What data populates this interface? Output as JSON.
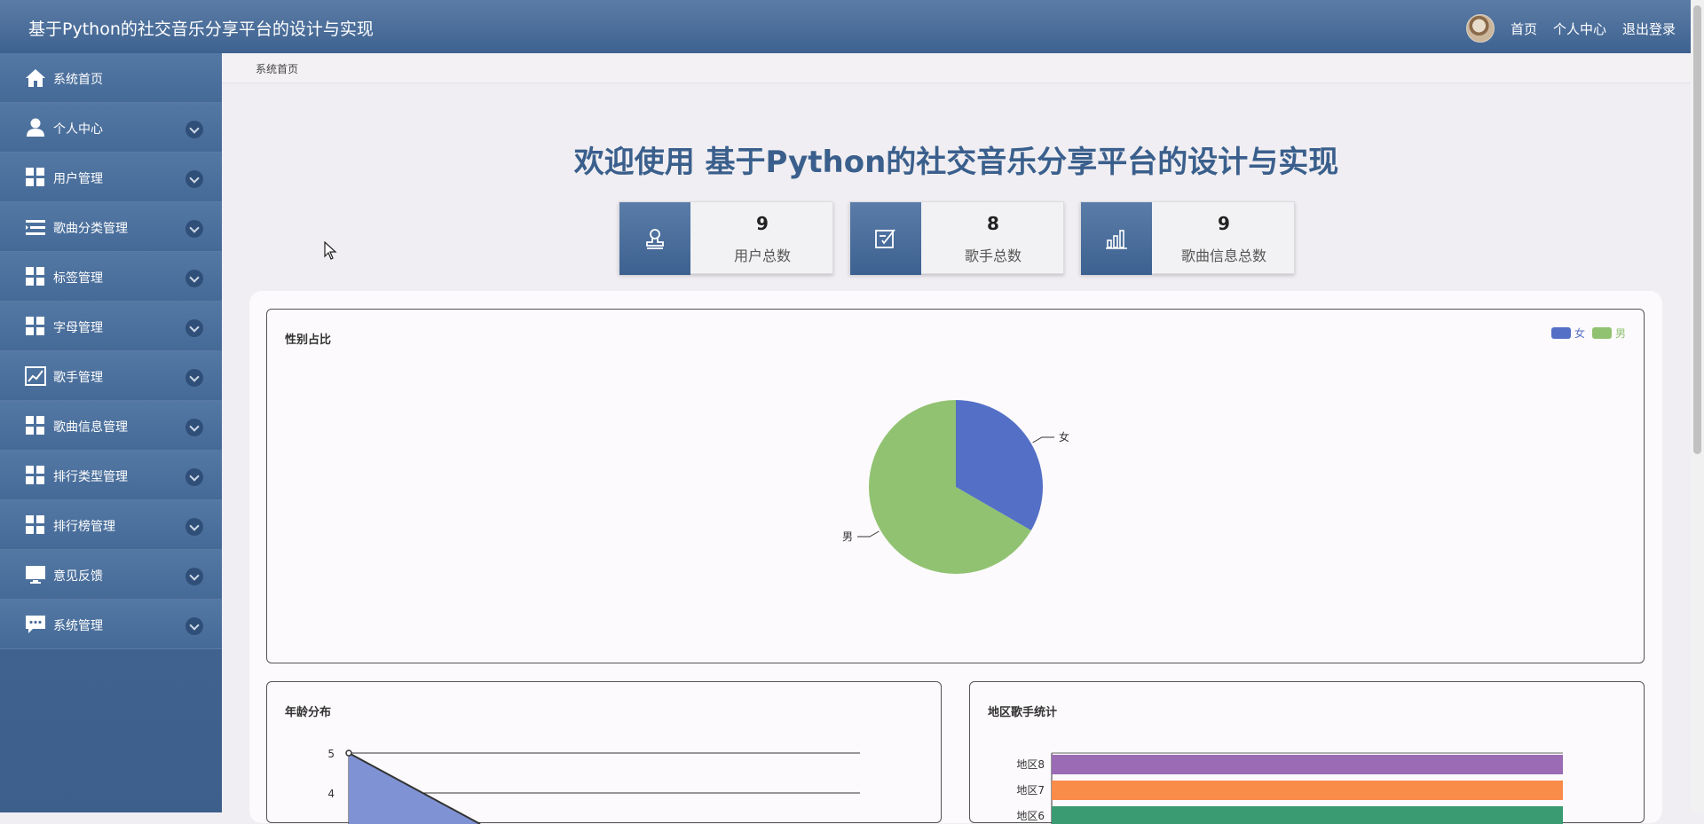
{
  "header": {
    "app_title": "基于Python的社交音乐分享平台的设计与实现",
    "links": [
      "首页",
      "个人中心",
      "退出登录"
    ]
  },
  "sidebar": {
    "items": [
      {
        "label": "系统首页",
        "icon": "home-icon",
        "has_chevron": false
      },
      {
        "label": "个人中心",
        "icon": "person-icon",
        "has_chevron": true
      },
      {
        "label": "用户管理",
        "icon": "grid-icon",
        "has_chevron": true
      },
      {
        "label": "歌曲分类管理",
        "icon": "list-icon",
        "has_chevron": true
      },
      {
        "label": "标签管理",
        "icon": "grid-icon",
        "has_chevron": true
      },
      {
        "label": "字母管理",
        "icon": "grid-icon",
        "has_chevron": true
      },
      {
        "label": "歌手管理",
        "icon": "trend-chart-icon",
        "has_chevron": true
      },
      {
        "label": "歌曲信息管理",
        "icon": "grid-icon",
        "has_chevron": true
      },
      {
        "label": "排行类型管理",
        "icon": "grid-icon",
        "has_chevron": true
      },
      {
        "label": "排行榜管理",
        "icon": "grid-icon",
        "has_chevron": true
      },
      {
        "label": "意见反馈",
        "icon": "monitor-icon",
        "has_chevron": true
      },
      {
        "label": "系统管理",
        "icon": "chat-icon",
        "has_chevron": true
      }
    ]
  },
  "breadcrumb": "系统首页",
  "welcome": "欢迎使用 基于Python的社交音乐分享平台的设计与实现",
  "stats": [
    {
      "value": "9",
      "label": "用户总数",
      "icon": "stamp-icon"
    },
    {
      "value": "8",
      "label": "歌手总数",
      "icon": "edit-icon"
    },
    {
      "value": "9",
      "label": "歌曲信息总数",
      "icon": "bar-chart-icon"
    }
  ],
  "colors": {
    "header": "#4a6d99",
    "female": "#5470c6",
    "male": "#91c271",
    "region8": "#9b6bb5",
    "region7": "#fa8c4a",
    "region6": "#3a9a72"
  },
  "chart_data": [
    {
      "type": "pie",
      "title": "性别占比",
      "legend": [
        "女",
        "男"
      ],
      "legend_position": "top-right",
      "series": [
        {
          "name": "女",
          "value": 1
        },
        {
          "name": "男",
          "value": 2
        }
      ]
    },
    {
      "type": "area",
      "title": "年龄分布",
      "y_ticks": [
        4,
        5
      ],
      "grid": true
    },
    {
      "type": "bar",
      "orientation": "horizontal",
      "title": "地区歌手统计",
      "categories": [
        "地区8",
        "地区7",
        "地区6"
      ],
      "grid": true
    }
  ]
}
